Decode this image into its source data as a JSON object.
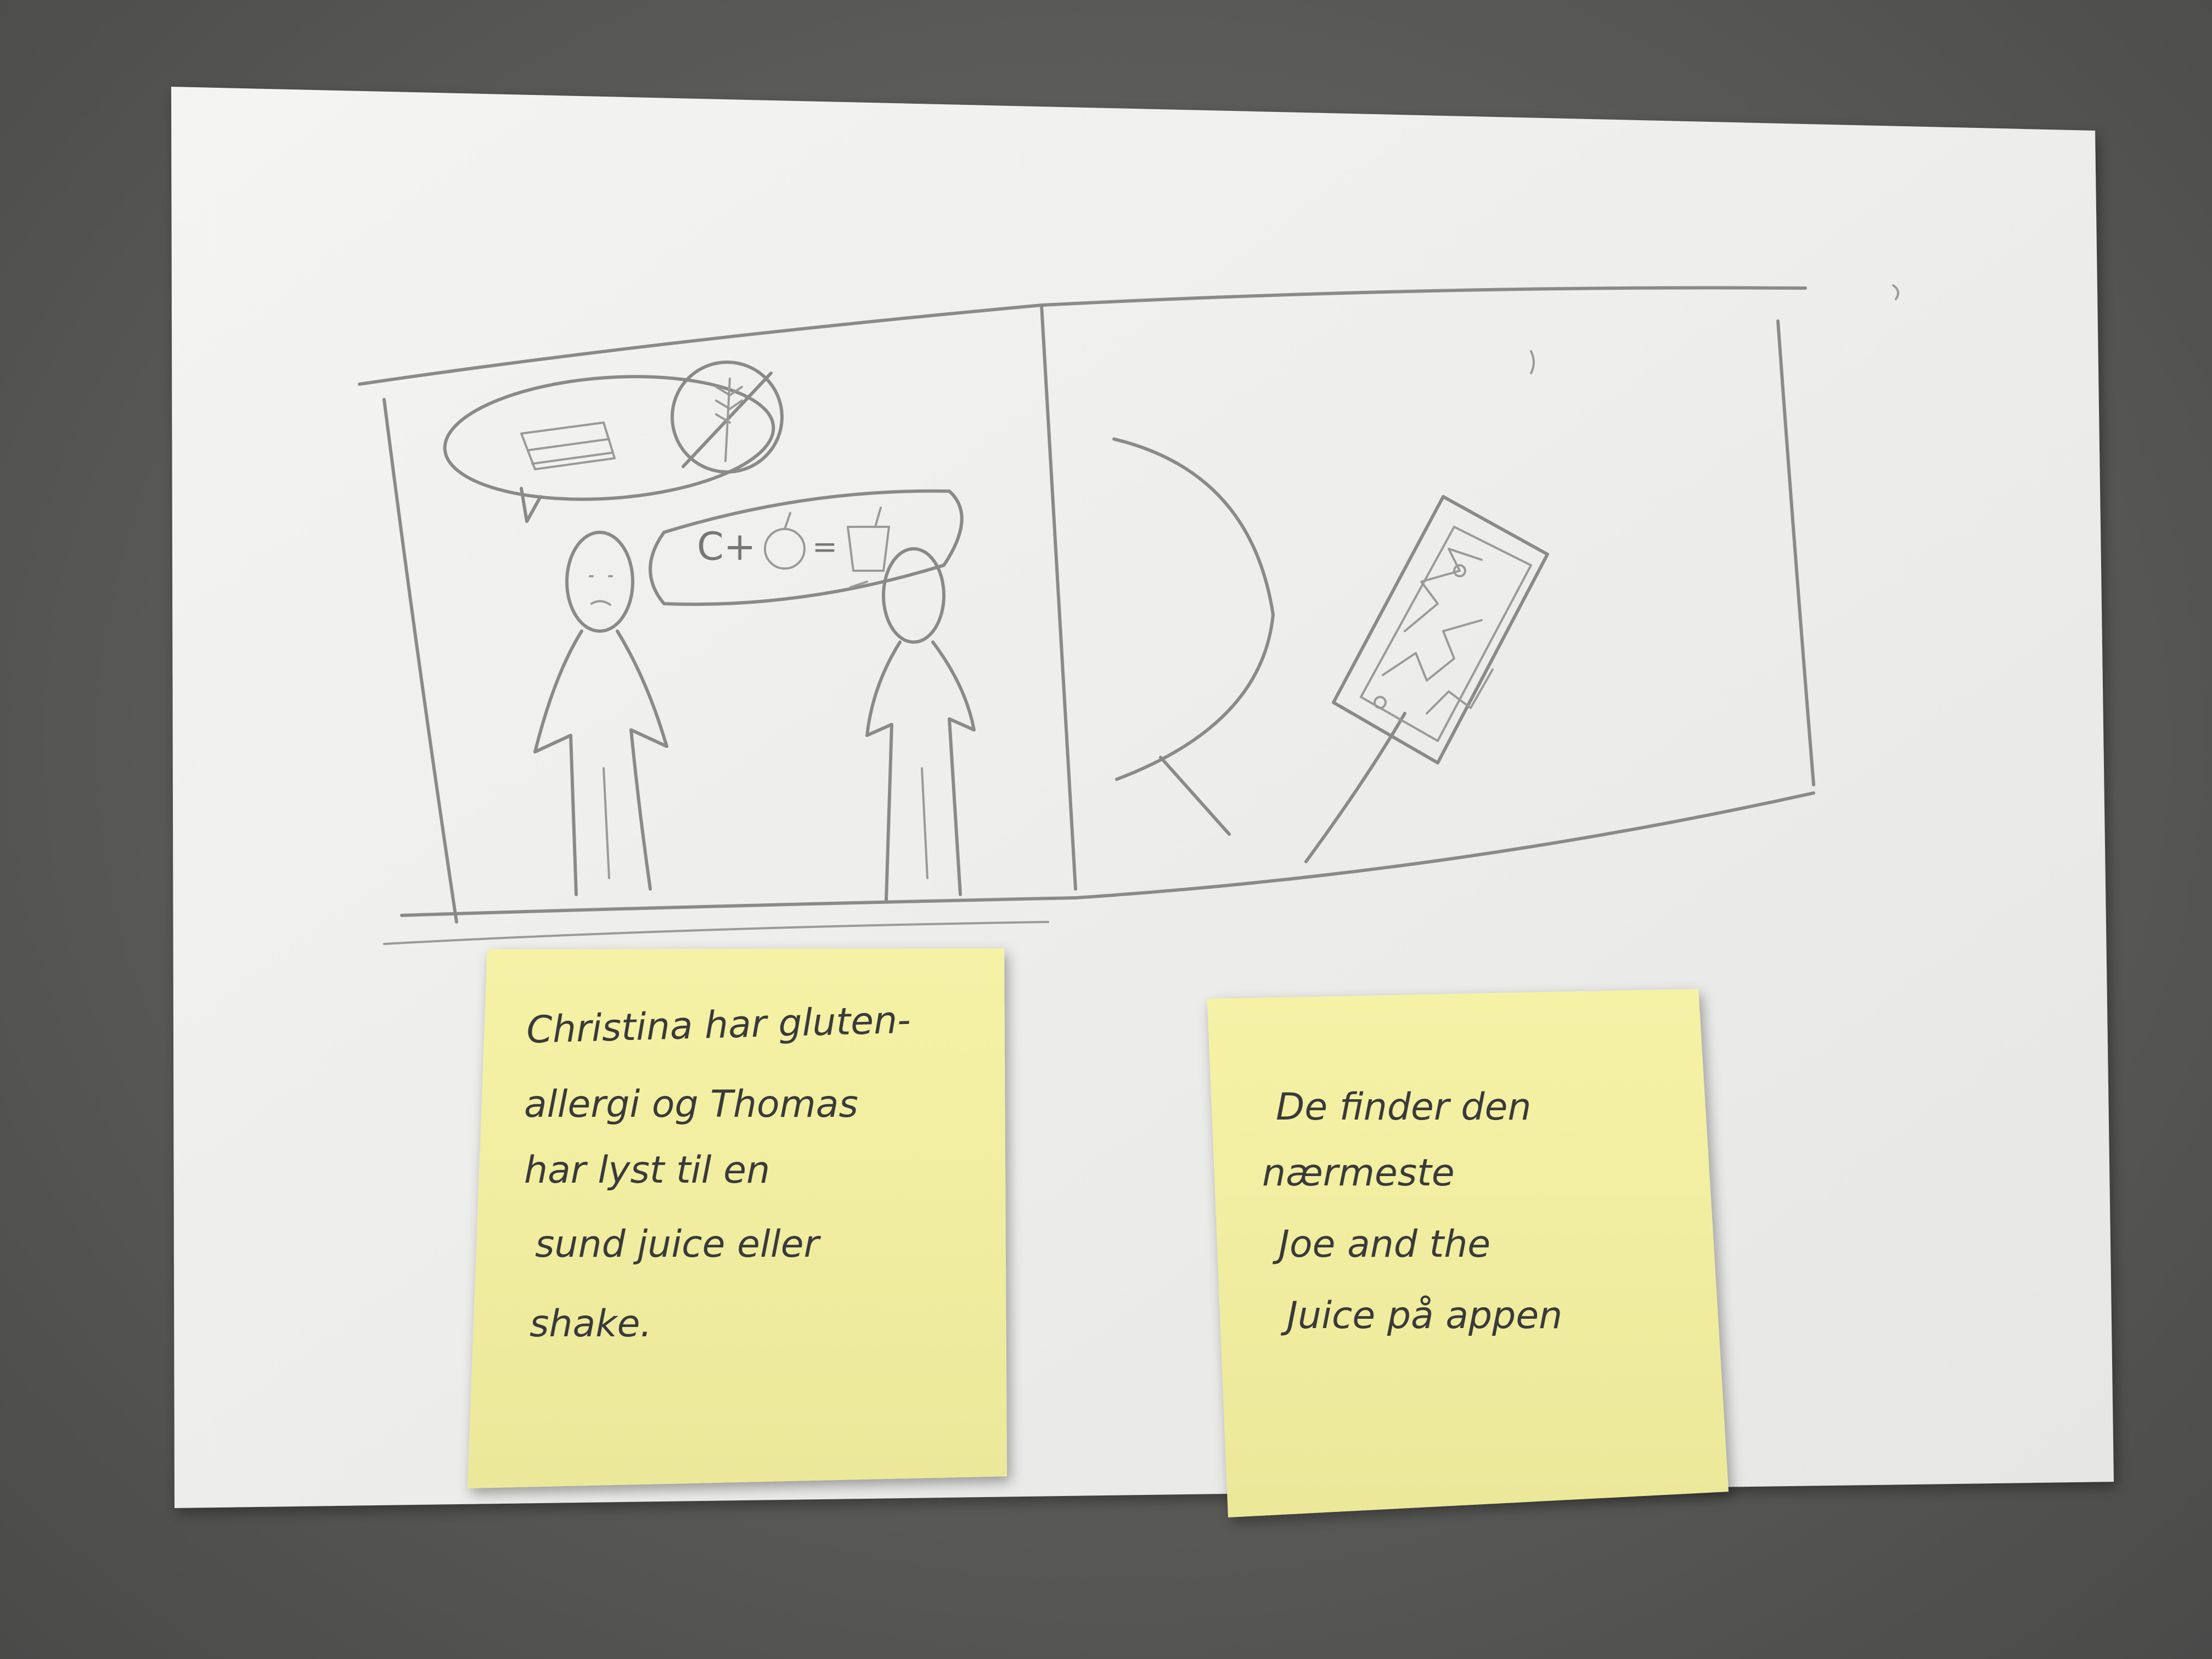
{
  "note_left": {
    "lines": [
      "Christina har gluten-",
      "allergi og Thomas",
      "har lyst til en",
      "sund juice eller",
      "shake."
    ]
  },
  "note_right": {
    "lines": [
      "De finder den",
      "nærmeste",
      "Joe and the",
      "Juice på appen"
    ]
  },
  "colors": {
    "background": "#5a5a58",
    "paper": "#f2f2f0",
    "sticky_note": "#f3f0a0",
    "pencil": "#8a8a8a"
  }
}
